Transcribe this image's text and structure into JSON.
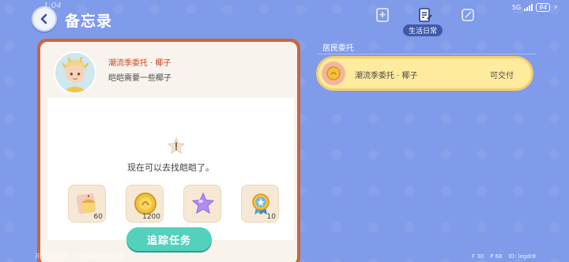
{
  "header": {
    "title": "备忘录",
    "clock": "1:04"
  },
  "status_bar": {
    "network": "5G",
    "battery": "94"
  },
  "tabs": [
    {
      "name": "tab-bookmark",
      "icon": "bookmark-plus-icon"
    },
    {
      "name": "tab-daily",
      "icon": "document-edit-icon"
    },
    {
      "name": "tab-edit",
      "icon": "pencil-note-icon"
    }
  ],
  "active_tab_label": "生活日常",
  "memo": {
    "quest_name": "潮流季委托 · 椰子",
    "quest_desc": "皑皑需要一些椰子",
    "message": "现在可以去找皑皑了。",
    "rewards": [
      {
        "icon": "acorn-icon",
        "count": "60"
      },
      {
        "icon": "gold-coin-icon",
        "count": "1200"
      },
      {
        "icon": "purple-star-icon",
        "count": ""
      },
      {
        "icon": "blue-medal-icon",
        "count": "10"
      }
    ],
    "track_button": "追踪任务"
  },
  "footer_note": "开发测试版本，不代表最终游戏品质",
  "debug": {
    "fps": "F 30",
    "ping": "P 68",
    "id": "ID: legdr8"
  },
  "resident_section": {
    "title": "居民委托",
    "items": [
      {
        "icon": "coin-icon",
        "name": "潮流季委托 · 椰子",
        "status": "可交付"
      }
    ]
  }
}
